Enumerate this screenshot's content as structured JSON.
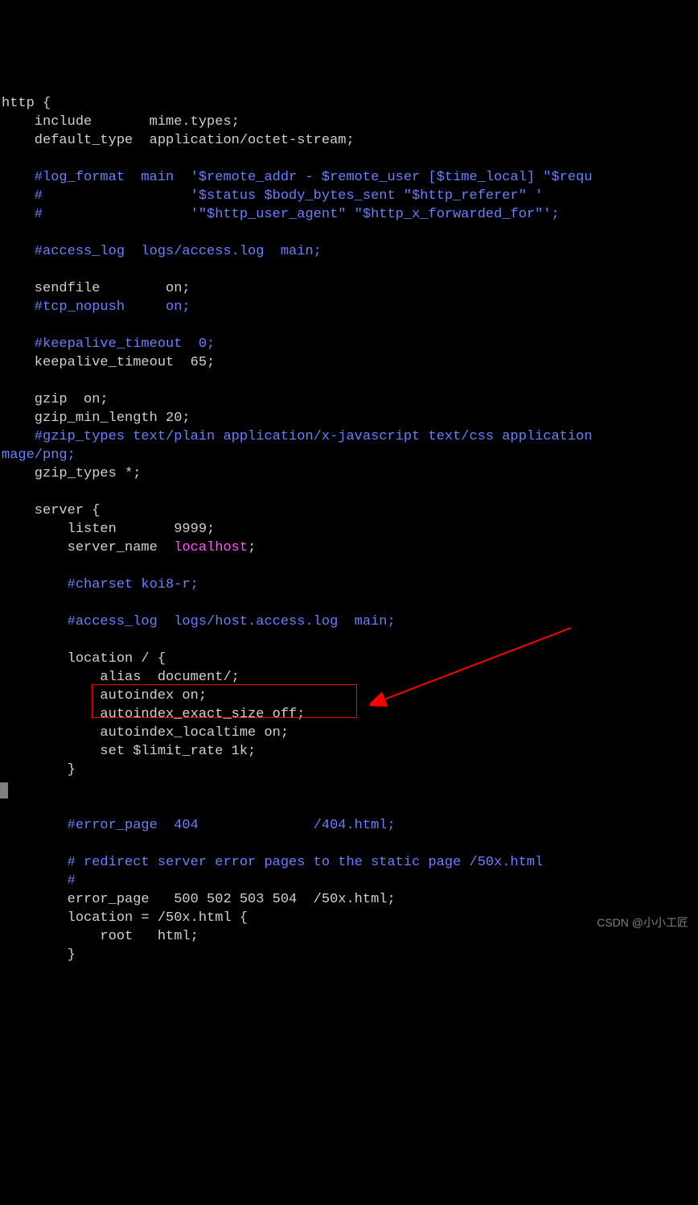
{
  "watermark": "CSDN @小小工匠",
  "code": {
    "l1": "http {",
    "l2": "    include       mime.types;",
    "l3": "    default_type  application/octet-stream;",
    "l4": "",
    "l5": "    #log_format  main  '$remote_addr - $remote_user [$time_local] \"$requ",
    "l6": "    #                  '$status $body_bytes_sent \"$http_referer\" '",
    "l7": "    #                  '\"$http_user_agent\" \"$http_x_forwarded_for\"';",
    "l8": "",
    "l9": "    #access_log  logs/access.log  main;",
    "l10": "",
    "l11": "    sendfile        on;",
    "l12": "    #tcp_nopush     on;",
    "l13": "",
    "l14": "    #keepalive_timeout  0;",
    "l15": "    keepalive_timeout  65;",
    "l16": "",
    "l17": "    gzip  on;",
    "l18": "    gzip_min_length 20;",
    "l19a": "    #gzip_types text/plain application/x-javascript text/css application",
    "l19b": "mage/png;",
    "l20": "    gzip_types *;",
    "l21": "",
    "l22": "    server {",
    "l23": "        listen       9999;",
    "l24a": "        server_name  ",
    "l24b": "localhost",
    "l24c": ";",
    "l25": "",
    "l26": "        #charset koi8-r;",
    "l27": "",
    "l28": "        #access_log  logs/host.access.log  main;",
    "l29": "",
    "l30": "        location / {",
    "l31": "            alias  document/;",
    "l32": "            autoindex on;",
    "l33": "            autoindex_exact_size off;",
    "l34": "            autoindex_localtime on;",
    "l35": "            set $limit_rate 1k;",
    "l36": "        }",
    "l37": "",
    "l38": "",
    "l39": "        #error_page  404              /404.html;",
    "l40": "",
    "l41": "        # redirect server error pages to the static page /50x.html",
    "l42": "        #",
    "l43": "        error_page   500 502 503 504  /50x.html;",
    "l44": "        location = /50x.html {",
    "l45": "            root   html;",
    "l46": "        }"
  }
}
